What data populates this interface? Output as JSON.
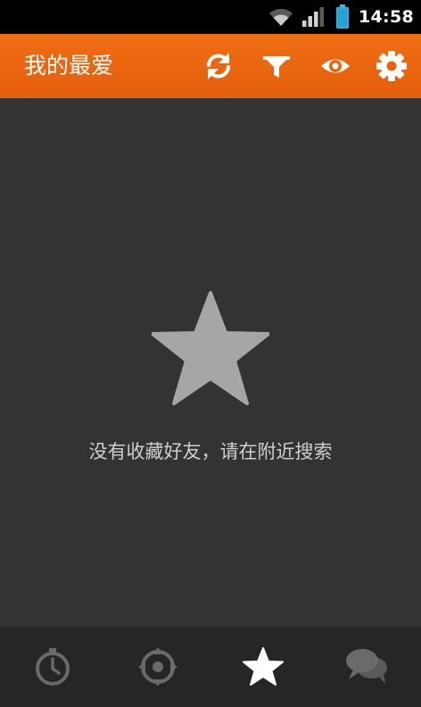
{
  "status_bar": {
    "time": "14:58",
    "icons": [
      "wifi-icon",
      "signal-icon",
      "battery-icon"
    ]
  },
  "action_bar": {
    "title": "我的最爱",
    "background_color": "#e8640f",
    "actions": [
      {
        "name": "refresh-icon"
      },
      {
        "name": "filter-icon"
      },
      {
        "name": "eye-icon"
      },
      {
        "name": "gear-icon"
      }
    ]
  },
  "empty_state": {
    "icon": "star-icon",
    "message": "没有收藏好友，请在附近搜索"
  },
  "tab_bar": {
    "tabs": [
      {
        "name": "stopwatch-icon",
        "active": false
      },
      {
        "name": "crosshair-icon",
        "active": false
      },
      {
        "name": "star-icon",
        "active": true
      },
      {
        "name": "chat-bubbles-icon",
        "active": false
      }
    ]
  }
}
